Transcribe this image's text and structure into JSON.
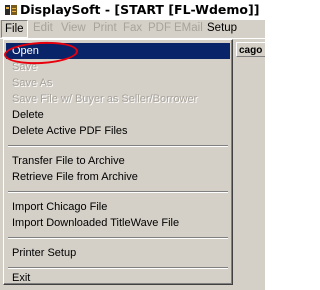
{
  "window": {
    "title": "DisplaySoft - [START    [FL-Wdemo]]",
    "icon": "displaysoft-app-icon"
  },
  "menubar": {
    "items": [
      {
        "label": "File",
        "state": "active"
      },
      {
        "label": "Edit",
        "state": "disabled"
      },
      {
        "label": "View",
        "state": "disabled"
      },
      {
        "label": "Print",
        "state": "disabled"
      },
      {
        "label": "Fax",
        "state": "disabled"
      },
      {
        "label": "PDF",
        "state": "disabled"
      },
      {
        "label": "EMail",
        "state": "disabled"
      },
      {
        "label": "Setup",
        "state": "enabled"
      }
    ]
  },
  "grid": {
    "header": "cago"
  },
  "file_menu": {
    "items": [
      {
        "label": "Open",
        "state": "highlighted"
      },
      {
        "label": "Save",
        "state": "disabled"
      },
      {
        "label": "Save As",
        "state": "disabled"
      },
      {
        "label": "Save File w/ Buyer as Seller/Borrower",
        "state": "disabled"
      },
      {
        "label": "Delete",
        "state": "enabled"
      },
      {
        "label": "Delete Active PDF Files",
        "state": "enabled"
      },
      {
        "label": "Transfer File to Archive",
        "state": "enabled"
      },
      {
        "label": "Retrieve File from Archive",
        "state": "enabled"
      },
      {
        "label": "Import Chicago File",
        "state": "enabled"
      },
      {
        "label": "Import Downloaded TitleWave File",
        "state": "enabled"
      },
      {
        "label": "Printer Setup",
        "state": "enabled"
      },
      {
        "label": "Exit",
        "state": "enabled"
      }
    ]
  },
  "colors": {
    "highlight": "#0a246a",
    "annotation": "#e8000d",
    "face": "#d4d0c8"
  }
}
